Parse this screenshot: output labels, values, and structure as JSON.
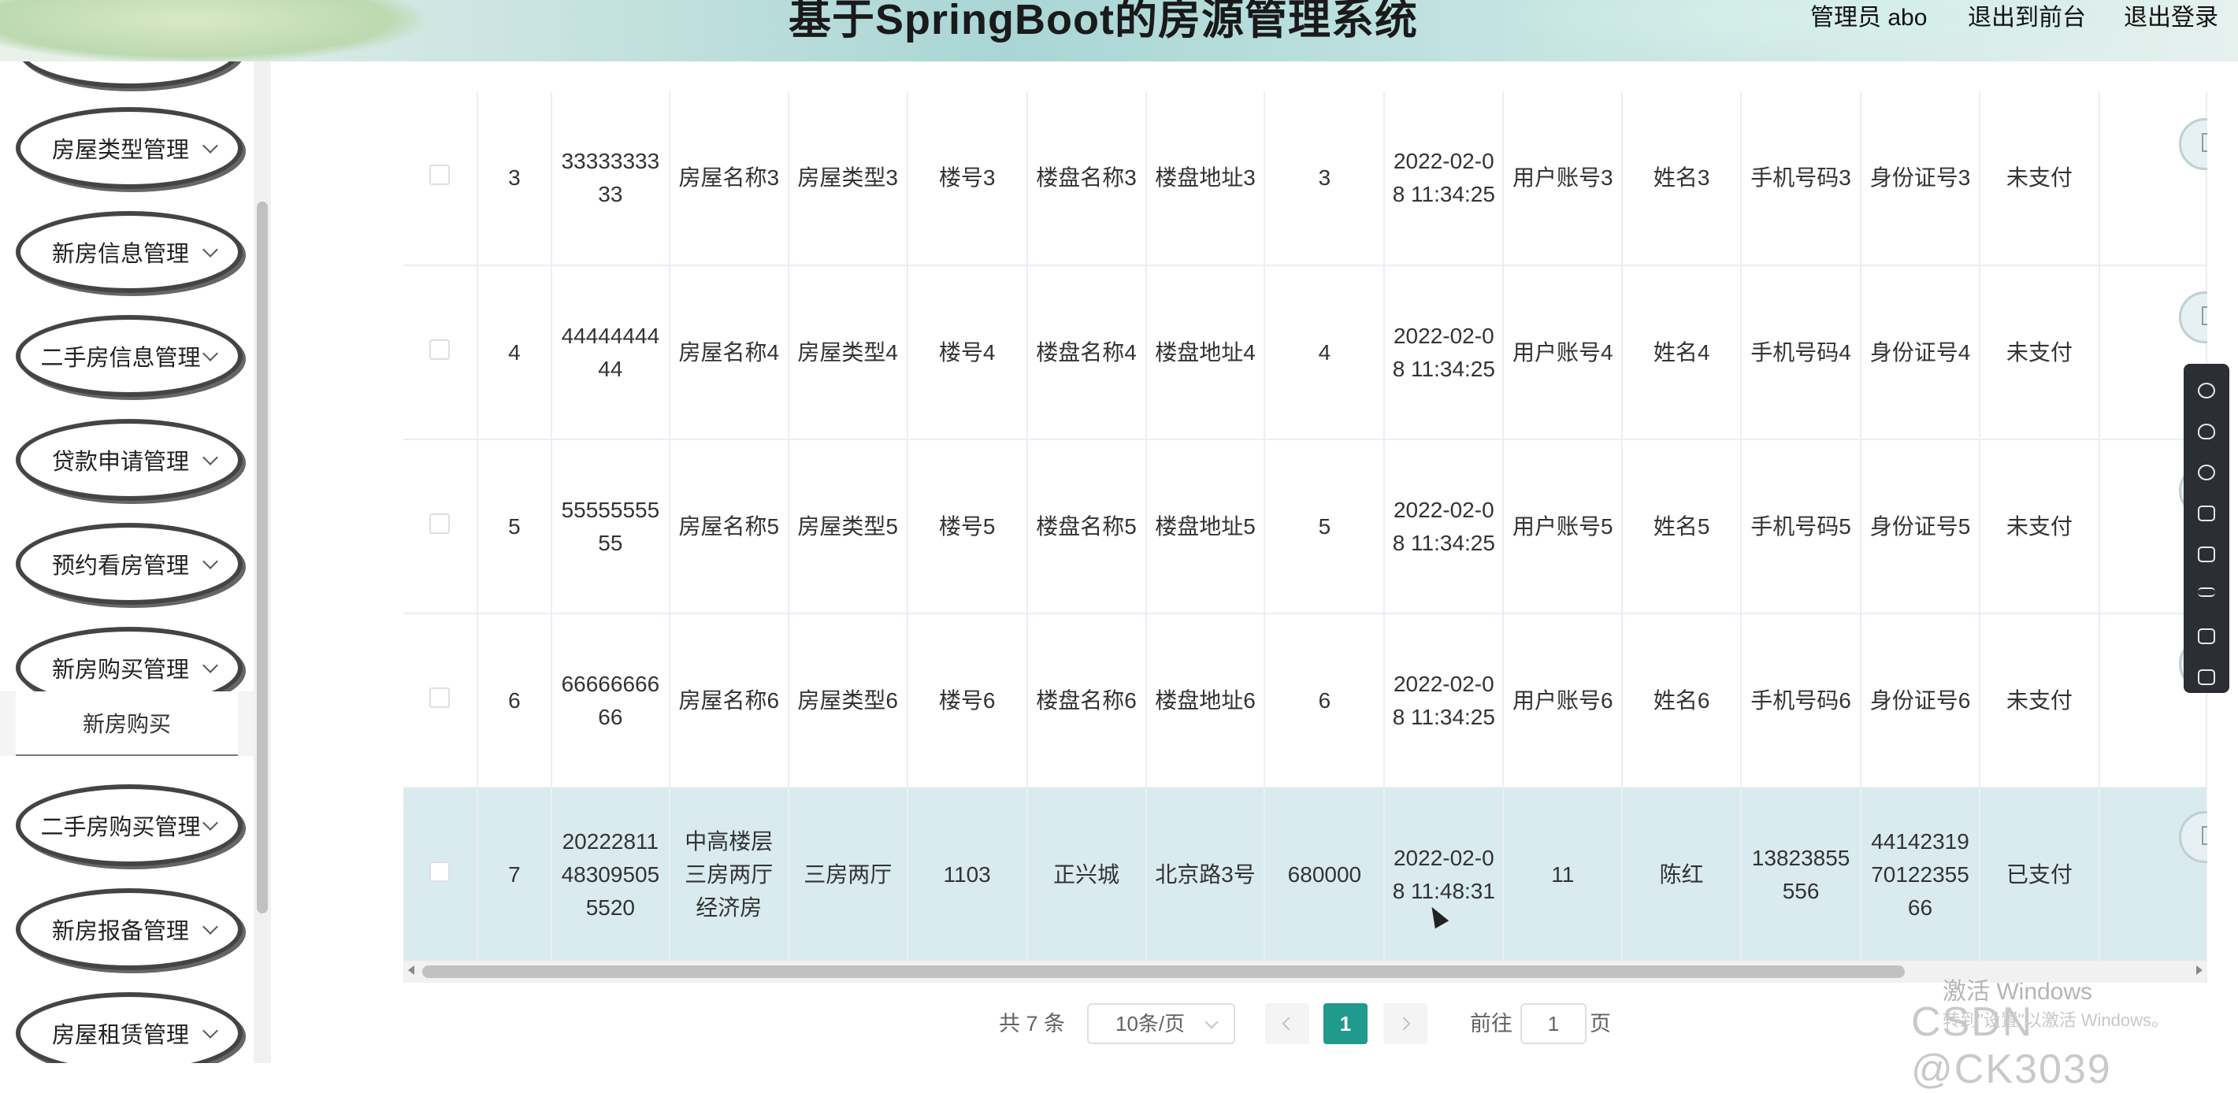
{
  "header": {
    "title": "基于SpringBoot的房源管理系统",
    "user": "管理员 abo",
    "back_front": "退出到前台",
    "logout": "退出登录"
  },
  "sidebar": {
    "items": [
      {
        "label": "房屋类型管理"
      },
      {
        "label": "新房信息管理"
      },
      {
        "label": "二手房信息管理"
      },
      {
        "label": "贷款申请管理"
      },
      {
        "label": "预约看房管理"
      },
      {
        "label": "新房购买管理"
      },
      {
        "label": "二手房购买管理"
      },
      {
        "label": "新房报备管理"
      },
      {
        "label": "房屋租赁管理"
      }
    ],
    "submenu": "新房购买"
  },
  "table": {
    "rows": [
      {
        "index": "3",
        "order_no": "3333333333",
        "house_name": "房屋名称3",
        "house_type": "房屋类型3",
        "building_no": "楼号3",
        "estate_name": "楼盘名称3",
        "estate_address": "楼盘地址3",
        "price": "3",
        "time": "2022-02-08 11:34:25",
        "account": "用户账号3",
        "name": "姓名3",
        "phone": "手机号码3",
        "id_card": "身份证号3",
        "status": "未支付"
      },
      {
        "index": "4",
        "order_no": "4444444444",
        "house_name": "房屋名称4",
        "house_type": "房屋类型4",
        "building_no": "楼号4",
        "estate_name": "楼盘名称4",
        "estate_address": "楼盘地址4",
        "price": "4",
        "time": "2022-02-08 11:34:25",
        "account": "用户账号4",
        "name": "姓名4",
        "phone": "手机号码4",
        "id_card": "身份证号4",
        "status": "未支付"
      },
      {
        "index": "5",
        "order_no": "5555555555",
        "house_name": "房屋名称5",
        "house_type": "房屋类型5",
        "building_no": "楼号5",
        "estate_name": "楼盘名称5",
        "estate_address": "楼盘地址5",
        "price": "5",
        "time": "2022-02-08 11:34:25",
        "account": "用户账号5",
        "name": "姓名5",
        "phone": "手机号码5",
        "id_card": "身份证号5",
        "status": "未支付"
      },
      {
        "index": "6",
        "order_no": "6666666666",
        "house_name": "房屋名称6",
        "house_type": "房屋类型6",
        "building_no": "楼号6",
        "estate_name": "楼盘名称6",
        "estate_address": "楼盘地址6",
        "price": "6",
        "time": "2022-02-08 11:34:25",
        "account": "用户账号6",
        "name": "姓名6",
        "phone": "手机号码6",
        "id_card": "身份证号6",
        "status": "未支付"
      },
      {
        "index": "7",
        "order_no": "20222811483095055520",
        "house_name": "中高楼层三房两厅经济房",
        "house_type": "三房两厅",
        "building_no": "1103",
        "estate_name": "正兴城",
        "estate_address": "北京路3号",
        "price": "680000",
        "time": "2022-02-08 11:48:31",
        "account": "11",
        "name": "陈红",
        "phone": "13823855556",
        "id_card": "441423197012235566",
        "status": "已支付"
      }
    ]
  },
  "pagination": {
    "total": "共 7 条",
    "page_size": "10条/页",
    "current": "1",
    "goto_label": "前往",
    "goto_value": "1",
    "page_label": "页"
  },
  "watermark": {
    "activate": "激活 Windows",
    "activate_sub": "转到\"设置\"以激活 Windows。",
    "csdn": "CSDN @CK3039"
  },
  "colors": {
    "accent": "#1f9a8c",
    "selected_row": "#d9ebee"
  },
  "icons": [
    "chevron-down-icon",
    "checkbox-icon",
    "edit-icon",
    "chevron-left-icon",
    "chevron-right-icon",
    "screen-record-toolbar"
  ]
}
